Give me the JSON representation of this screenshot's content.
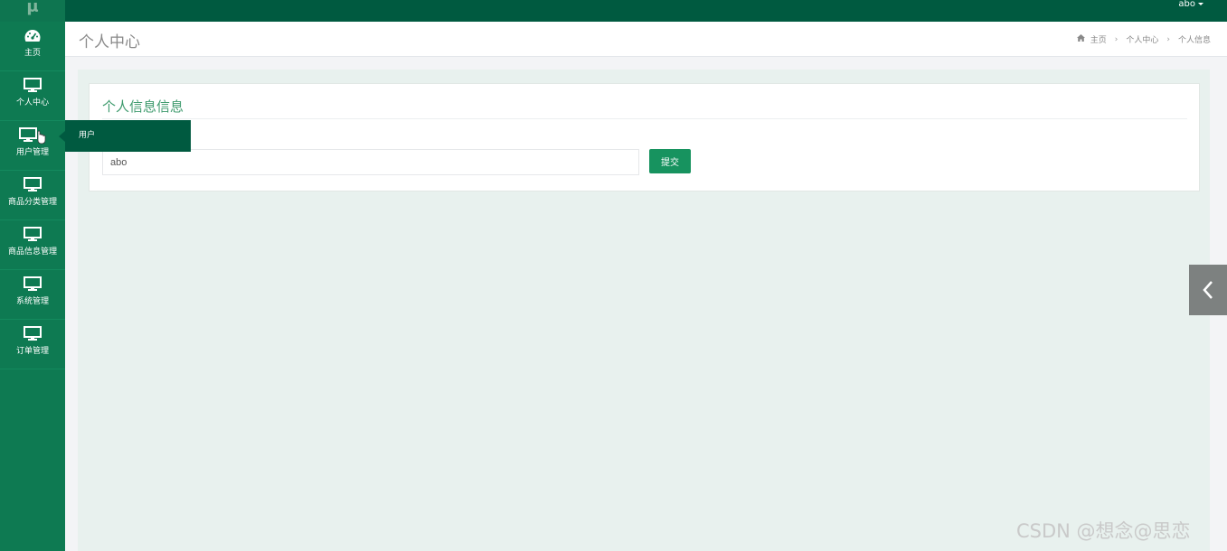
{
  "app": {
    "logo": "μ",
    "user": "abo"
  },
  "sidebar": {
    "items": [
      {
        "label": "主页",
        "icon": "dashboard-icon"
      },
      {
        "label": "个人中心",
        "icon": "monitor-icon"
      },
      {
        "label": "用户管理",
        "icon": "monitor-icon"
      },
      {
        "label": "商品分类管理",
        "icon": "monitor-icon"
      },
      {
        "label": "商品信息管理",
        "icon": "monitor-icon"
      },
      {
        "label": "系统管理",
        "icon": "monitor-icon"
      },
      {
        "label": "订单管理",
        "icon": "monitor-icon"
      }
    ],
    "flyout": {
      "label": "用户"
    }
  },
  "header": {
    "title": "个人中心",
    "breadcrumb": [
      "主页",
      "个人中心",
      "个人信息"
    ]
  },
  "panel": {
    "title": "个人信息信息",
    "username_value": "abo",
    "submit_label": "提交"
  },
  "watermark": "CSDN @想念@思恋",
  "colors": {
    "topbar": "#005a40",
    "sidebar": "#0e7a52",
    "accent": "#17935f",
    "content_bg": "#e8f1ee"
  }
}
